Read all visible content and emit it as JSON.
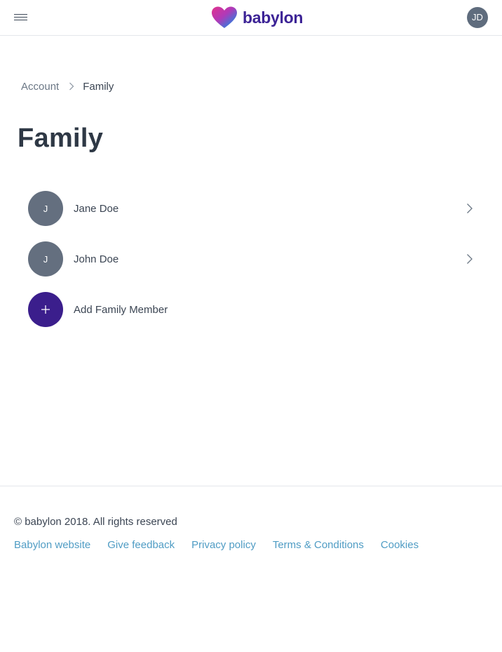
{
  "header": {
    "logo_text": "babylon",
    "user_initials": "JD"
  },
  "breadcrumb": {
    "items": [
      "Account",
      "Family"
    ]
  },
  "page": {
    "title": "Family"
  },
  "family": {
    "members": [
      {
        "initial": "J",
        "name": "Jane Doe"
      },
      {
        "initial": "J",
        "name": "John Doe"
      }
    ],
    "add_label": "Add Family Member"
  },
  "footer": {
    "copyright": "© babylon 2018. All rights reserved",
    "links": [
      "Babylon website",
      "Give feedback",
      "Privacy policy",
      "Terms & Conditions",
      "Cookies"
    ]
  },
  "colors": {
    "brand_purple": "#3d2496",
    "add_button": "#3b1e8c",
    "avatar_grey": "#646f7f",
    "link_blue": "#4f9cc4",
    "text_dark": "#2e3845"
  },
  "icons": {
    "menu": "hamburger-menu-icon",
    "logo": "heart-logo-icon",
    "breadcrumb_separator": "chevron-right-icon",
    "row_arrow": "chevron-right-icon",
    "add": "plus-icon"
  }
}
